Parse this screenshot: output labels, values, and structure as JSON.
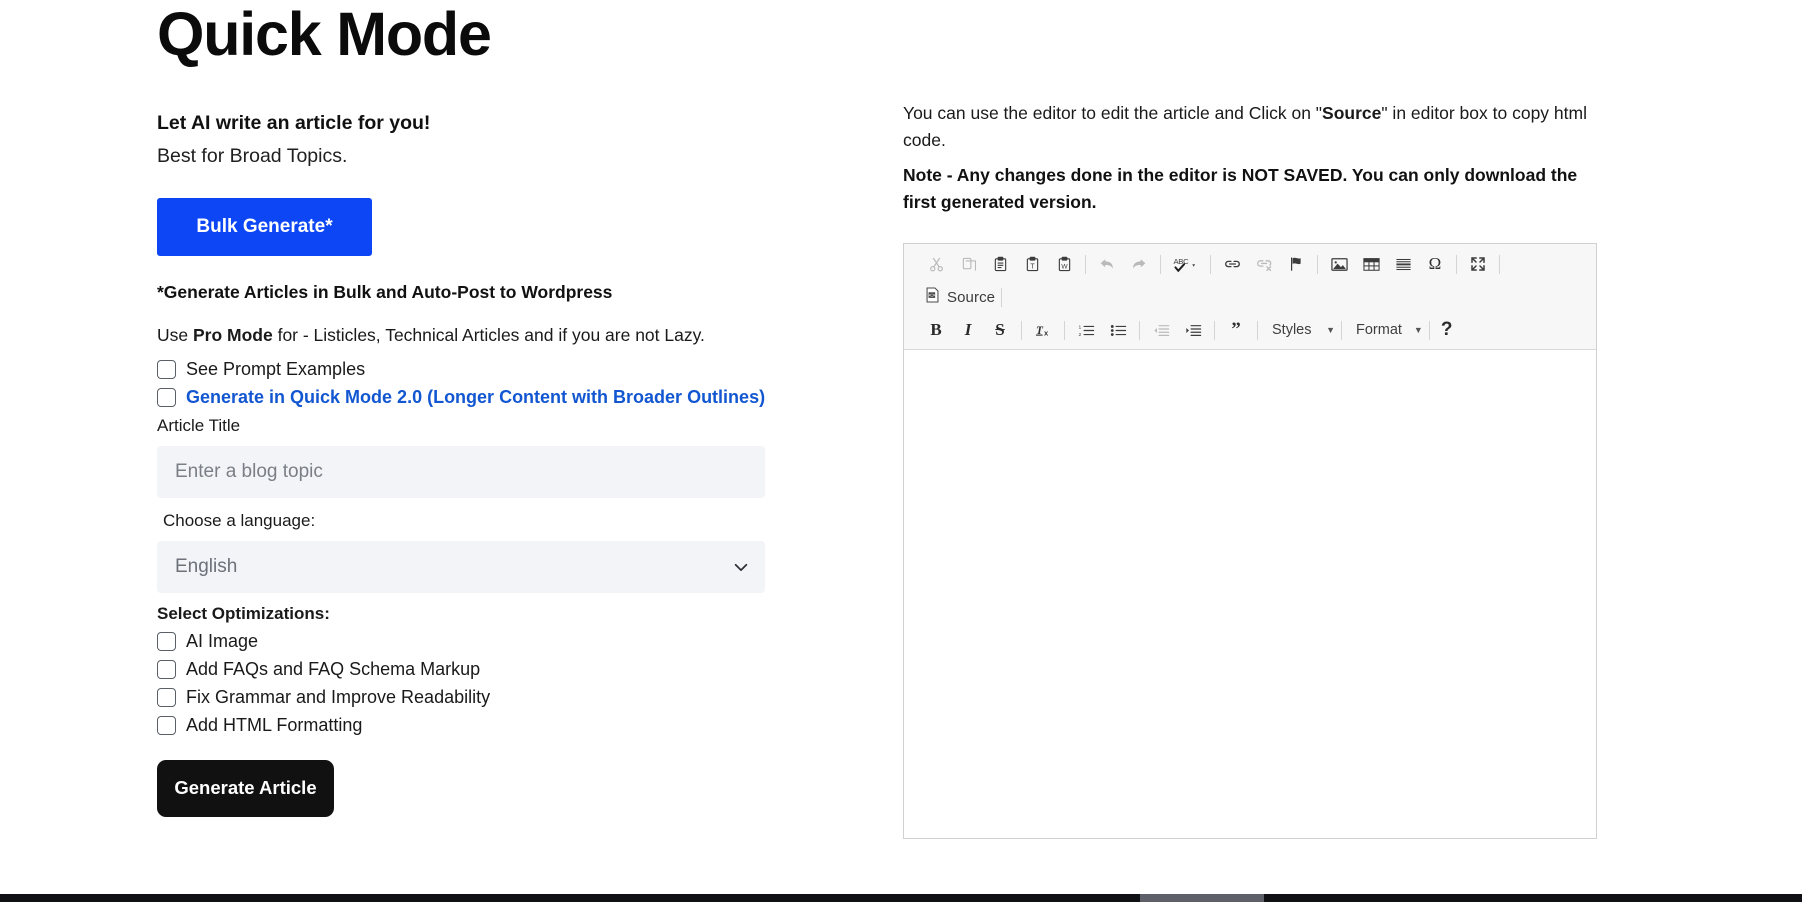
{
  "page": {
    "title": "Quick Mode"
  },
  "intro": {
    "headline": "Let AI write an article for you!",
    "subline": "Best for Broad Topics.",
    "bulk_button": "Bulk Generate*",
    "bulk_note": "*Generate Articles in Bulk and Auto-Post to Wordpress",
    "pro_prefix": "Use ",
    "pro_strong": "Pro Mode",
    "pro_suffix": " for - Listicles, Technical Articles and if you are not Lazy."
  },
  "options": {
    "see_prompt_examples": "See Prompt Examples",
    "quick_mode_2": "Generate in Quick Mode 2.0 (Longer Content with Broader Outlines)"
  },
  "form": {
    "article_title_label": "Article Title",
    "article_title_placeholder": "Enter a blog topic",
    "article_title_value": "",
    "language_label": "Choose a language:",
    "language_value": "English",
    "language_options": [
      "English"
    ],
    "optimizations_label": "Select Optimizations:",
    "optimizations": [
      "AI Image",
      "Add FAQs and FAQ Schema Markup",
      "Fix Grammar and Improve Readability",
      "Add HTML Formatting"
    ],
    "generate_button": "Generate Article"
  },
  "editor_panel": {
    "help_prefix": "You can use the editor to edit the article and Click on \"",
    "help_strong": "Source",
    "help_suffix": "\" in editor box to copy html code.",
    "note": "Note - Any changes done in the editor is NOT SAVED. You can only download the first generated version.",
    "content": ""
  },
  "toolbar": {
    "row1": [
      {
        "name": "cut-icon",
        "title": "Cut",
        "dim": true
      },
      {
        "name": "copy-icon",
        "title": "Copy",
        "dim": true
      },
      {
        "name": "paste-icon",
        "title": "Paste",
        "dim": false
      },
      {
        "name": "paste-text-icon",
        "title": "Paste as plain text",
        "dim": false
      },
      {
        "name": "paste-word-icon",
        "title": "Paste from Word",
        "dim": false
      },
      {
        "name": "undo-icon",
        "title": "Undo",
        "dim": true
      },
      {
        "name": "redo-icon",
        "title": "Redo",
        "dim": true
      },
      {
        "name": "spellcheck-icon",
        "title": "Spell Check As You Type",
        "dim": false
      },
      {
        "name": "link-icon",
        "title": "Link",
        "dim": false
      },
      {
        "name": "unlink-icon",
        "title": "Unlink",
        "dim": true
      },
      {
        "name": "anchor-flag-icon",
        "title": "Anchor",
        "dim": false
      },
      {
        "name": "image-icon",
        "title": "Image",
        "dim": false
      },
      {
        "name": "table-icon",
        "title": "Table",
        "dim": false
      },
      {
        "name": "horizontal-rule-icon",
        "title": "Horizontal Line",
        "dim": false
      },
      {
        "name": "omega-special-char-icon",
        "title": "Insert Special Character",
        "dim": false
      },
      {
        "name": "maximize-icon",
        "title": "Maximize",
        "dim": false
      }
    ],
    "source_label": "Source",
    "row3": [
      {
        "name": "bold-button",
        "label": "B",
        "kind": "b",
        "dim": false
      },
      {
        "name": "italic-button",
        "label": "I",
        "kind": "i",
        "dim": false
      },
      {
        "name": "strikethrough-button",
        "label": "S",
        "kind": "s",
        "dim": false
      },
      {
        "name": "remove-format-icon",
        "title": "Remove Format",
        "kind": "icon",
        "dim": false
      },
      {
        "name": "numbered-list-icon",
        "title": "Insert/Remove Numbered List",
        "kind": "icon",
        "dim": false
      },
      {
        "name": "bulleted-list-icon",
        "title": "Insert/Remove Bulleted List",
        "kind": "icon",
        "dim": false
      },
      {
        "name": "decrease-indent-icon",
        "title": "Decrease Indent",
        "kind": "icon",
        "dim": true
      },
      {
        "name": "increase-indent-icon",
        "title": "Increase Indent",
        "kind": "icon",
        "dim": false
      },
      {
        "name": "blockquote-icon",
        "title": "Block Quote",
        "kind": "icon",
        "dim": false
      }
    ],
    "styles_label": "Styles",
    "format_label": "Format",
    "help_label": "?"
  },
  "colors": {
    "primary_blue": "#0d47f5",
    "link_blue": "#1257d1",
    "dark_button": "#111111",
    "input_bg": "#f3f4f7",
    "toolbar_bg": "#f7f7f7"
  }
}
